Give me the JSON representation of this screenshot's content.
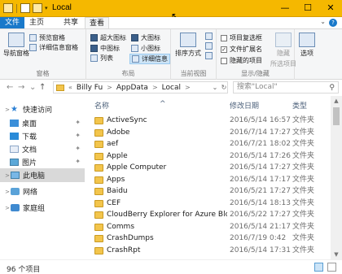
{
  "window": {
    "title": "Local",
    "minimize_glyph": "—",
    "maximize_glyph": "☐",
    "close_glyph": "✕",
    "quick_access_dropdown": "▾"
  },
  "menu": {
    "file": "文件",
    "home": "主页",
    "share": "共享",
    "view": "查看",
    "chevron": "⌄",
    "help": "?"
  },
  "ribbon": {
    "panes": {
      "nav_pane": "导航窗格",
      "preview_pane": "预览窗格",
      "details_pane": "详细信息窗格",
      "label": "窗格"
    },
    "layout": {
      "xl_icons": "超大图标",
      "large_icons": "大图标",
      "medium_icons": "中图标",
      "small_icons": "小图标",
      "list": "列表",
      "details": "详细信息",
      "label": "布局"
    },
    "current_view": {
      "sort_by": "排序方式",
      "label": "当前视图"
    },
    "show_hide": {
      "item_checkboxes": "项目复选框",
      "file_extensions": "文件扩展名",
      "hidden_items": "隐藏的项目",
      "hide_selected": "隐藏",
      "hide_selected_sub": "所选项目",
      "label": "显示/隐藏",
      "checked_glyph": "✓"
    },
    "options": "选项"
  },
  "address": {
    "back": "←",
    "forward": "→",
    "recent": "⌄",
    "up": "↑",
    "more": "«",
    "crumbs": [
      "Billy Fu",
      "AppData",
      "Local"
    ],
    "separator": ">",
    "dropdown": "⌄",
    "refresh": "↻",
    "search_placeholder": "搜索\"Local\"",
    "search_glyph": "⚲"
  },
  "nav": {
    "quick_access": "快速访问",
    "desktop": "桌面",
    "downloads": "下载",
    "documents": "文档",
    "pictures": "图片",
    "this_pc": "此电脑",
    "network": "网络",
    "homegroup": "家庭组",
    "expander": ">",
    "pin": "✦",
    "star": "★"
  },
  "columns": {
    "name": "名称",
    "date": "修改日期",
    "type": "类型",
    "sort_caret": "^"
  },
  "files": [
    {
      "name": "ActiveSync",
      "date": "2016/5/14 16:57",
      "type": "文件夹"
    },
    {
      "name": "Adobe",
      "date": "2016/7/14 17:27",
      "type": "文件夹"
    },
    {
      "name": "aef",
      "date": "2016/7/21 18:02",
      "type": "文件夹"
    },
    {
      "name": "Apple",
      "date": "2016/5/14 17:26",
      "type": "文件夹"
    },
    {
      "name": "Apple Computer",
      "date": "2016/5/14 17:27",
      "type": "文件夹"
    },
    {
      "name": "Apps",
      "date": "2016/5/14 17:17",
      "type": "文件夹"
    },
    {
      "name": "Baidu",
      "date": "2016/5/21 17:27",
      "type": "文件夹"
    },
    {
      "name": "CEF",
      "date": "2016/5/14 18:13",
      "type": "文件夹"
    },
    {
      "name": "CloudBerry Explorer for Azure Blob S...",
      "date": "2016/5/22 17:27",
      "type": "文件夹"
    },
    {
      "name": "Comms",
      "date": "2016/5/14 21:17",
      "type": "文件夹"
    },
    {
      "name": "CrashDumps",
      "date": "2016/7/19 0:42",
      "type": "文件夹"
    },
    {
      "name": "CrashRpt",
      "date": "2016/5/14 17:31",
      "type": "文件夹"
    }
  ],
  "status": {
    "item_count": "96 个项目"
  },
  "scrollbar": {
    "up": "▲",
    "down": "▼"
  }
}
